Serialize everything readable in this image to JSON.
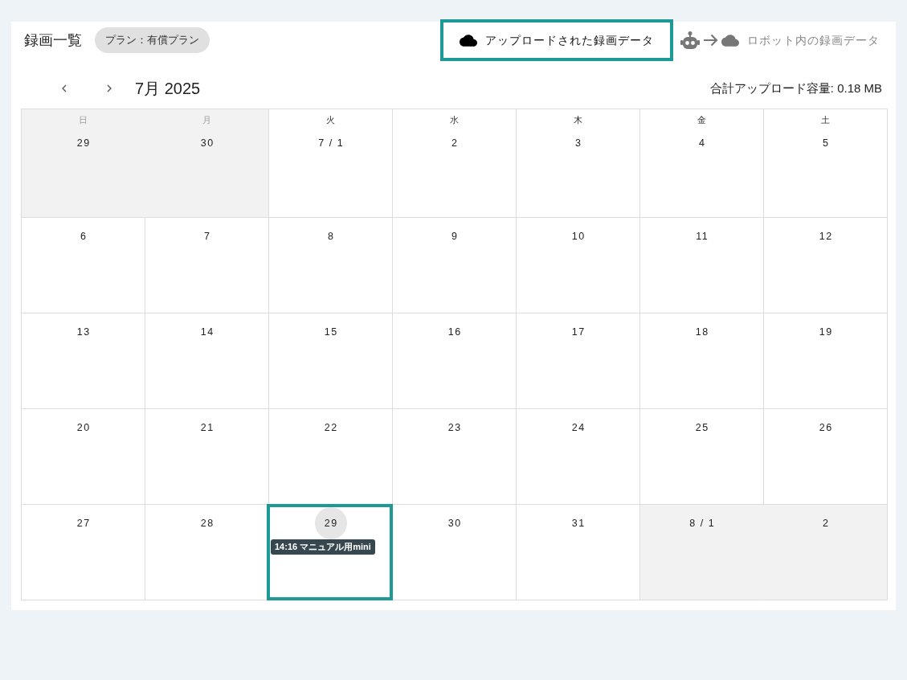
{
  "header": {
    "title": "録画一覧",
    "plan_badge": "プラン：有償プラン"
  },
  "source_tabs": [
    {
      "kind": "uploaded",
      "label": "アップロードされた録画データ",
      "selected": true
    },
    {
      "kind": "robot",
      "label": "ロボット内の録画データ",
      "selected": false
    }
  ],
  "calendar": {
    "month_title": "7月 2025",
    "total_upload": "合計アップロード容量: 0.18 MB",
    "weekdays": [
      "日",
      "月",
      "火",
      "水",
      "木",
      "金",
      "土"
    ],
    "weeks": [
      [
        {
          "label": "29",
          "in_month": false,
          "today": false,
          "highlighted": false
        },
        {
          "label": "30",
          "in_month": false,
          "today": false,
          "highlighted": false
        },
        {
          "label": "7 / 1",
          "in_month": true,
          "today": false,
          "highlighted": false
        },
        {
          "label": "2",
          "in_month": true,
          "today": false,
          "highlighted": false
        },
        {
          "label": "3",
          "in_month": true,
          "today": false,
          "highlighted": false
        },
        {
          "label": "4",
          "in_month": true,
          "today": false,
          "highlighted": false
        },
        {
          "label": "5",
          "in_month": true,
          "today": false,
          "highlighted": false
        }
      ],
      [
        {
          "label": "6",
          "in_month": true,
          "today": false,
          "highlighted": false
        },
        {
          "label": "7",
          "in_month": true,
          "today": false,
          "highlighted": false
        },
        {
          "label": "8",
          "in_month": true,
          "today": false,
          "highlighted": false
        },
        {
          "label": "9",
          "in_month": true,
          "today": false,
          "highlighted": false
        },
        {
          "label": "10",
          "in_month": true,
          "today": false,
          "highlighted": false
        },
        {
          "label": "11",
          "in_month": true,
          "today": false,
          "highlighted": false
        },
        {
          "label": "12",
          "in_month": true,
          "today": false,
          "highlighted": false
        }
      ],
      [
        {
          "label": "13",
          "in_month": true,
          "today": false,
          "highlighted": false
        },
        {
          "label": "14",
          "in_month": true,
          "today": false,
          "highlighted": false
        },
        {
          "label": "15",
          "in_month": true,
          "today": false,
          "highlighted": false
        },
        {
          "label": "16",
          "in_month": true,
          "today": false,
          "highlighted": false
        },
        {
          "label": "17",
          "in_month": true,
          "today": false,
          "highlighted": false
        },
        {
          "label": "18",
          "in_month": true,
          "today": false,
          "highlighted": false
        },
        {
          "label": "19",
          "in_month": true,
          "today": false,
          "highlighted": false
        }
      ],
      [
        {
          "label": "20",
          "in_month": true,
          "today": false,
          "highlighted": false
        },
        {
          "label": "21",
          "in_month": true,
          "today": false,
          "highlighted": false
        },
        {
          "label": "22",
          "in_month": true,
          "today": false,
          "highlighted": false
        },
        {
          "label": "23",
          "in_month": true,
          "today": false,
          "highlighted": false
        },
        {
          "label": "24",
          "in_month": true,
          "today": false,
          "highlighted": false
        },
        {
          "label": "25",
          "in_month": true,
          "today": false,
          "highlighted": false
        },
        {
          "label": "26",
          "in_month": true,
          "today": false,
          "highlighted": false
        }
      ],
      [
        {
          "label": "27",
          "in_month": true,
          "today": false,
          "highlighted": false
        },
        {
          "label": "28",
          "in_month": true,
          "today": false,
          "highlighted": false
        },
        {
          "label": "29",
          "in_month": true,
          "today": true,
          "highlighted": true,
          "events": [
            {
              "label": "14:16 マニュアル用mini"
            }
          ]
        },
        {
          "label": "30",
          "in_month": true,
          "today": false,
          "highlighted": false
        },
        {
          "label": "31",
          "in_month": true,
          "today": false,
          "highlighted": false
        },
        {
          "label": "8 / 1",
          "in_month": false,
          "today": false,
          "highlighted": false
        },
        {
          "label": "2",
          "in_month": false,
          "today": false,
          "highlighted": false
        }
      ]
    ]
  }
}
